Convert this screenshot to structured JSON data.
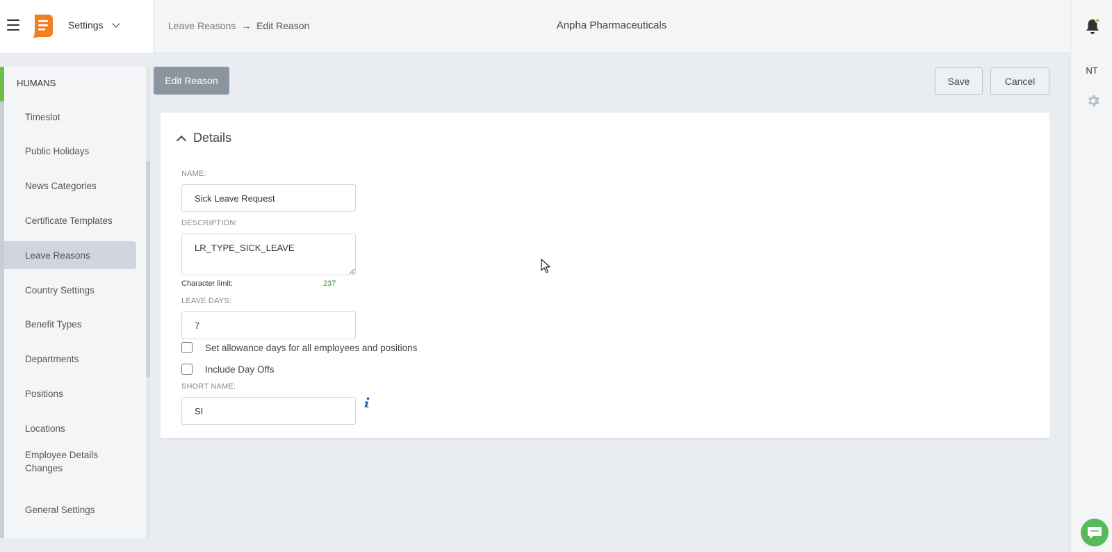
{
  "header": {
    "app_name": "Settings",
    "breadcrumb": {
      "parent": "Leave Reasons",
      "separator": "→",
      "current": "Edit Reason"
    },
    "company": "Anpha Pharmaceuticals"
  },
  "right_rail": {
    "avatar_initials": "NT"
  },
  "sidebar": {
    "section": "HUMANS",
    "items": [
      {
        "label": "Timeslot",
        "active": false
      },
      {
        "label": "Public Holidays",
        "active": false
      },
      {
        "label": "News Categories",
        "active": false
      },
      {
        "label": "Certificate Templates",
        "active": false
      },
      {
        "label": "Leave Reasons",
        "active": true
      },
      {
        "label": "Country Settings",
        "active": false
      },
      {
        "label": "Benefit Types",
        "active": false
      },
      {
        "label": "Departments",
        "active": false
      },
      {
        "label": "Positions",
        "active": false
      },
      {
        "label": "Locations",
        "active": false
      },
      {
        "label": "Employee Details Changes",
        "active": false
      },
      {
        "label": "General Settings",
        "active": false
      }
    ]
  },
  "toolbar": {
    "edit_label": "Edit Reason",
    "save_label": "Save",
    "cancel_label": "Cancel"
  },
  "form": {
    "section_title": "Details",
    "name_label": "NAME:",
    "name_value": "Sick Leave Request",
    "description_label": "DESCRIPTION:",
    "description_value": "LR_TYPE_SICK_LEAVE",
    "char_limit_label": "Character limit:",
    "char_limit_value": "237",
    "leave_days_label": "LEAVE DAYS:",
    "leave_days_value": "7",
    "allowance_checkbox_label": "Set allowance days for all employees and positions",
    "allowance_checked": false,
    "dayoffs_checkbox_label": "Include Day Offs",
    "dayoffs_checked": false,
    "short_name_label": "SHORT NAME:",
    "short_name_value": "SI"
  },
  "colors": {
    "accent_green": "#6cc04a",
    "logo_orange": "#f07f22",
    "edit_button": "#8a959f",
    "chat_green": "#5cb85c",
    "notification_dot": "#f5a623",
    "info_blue": "#1f5fb8"
  }
}
